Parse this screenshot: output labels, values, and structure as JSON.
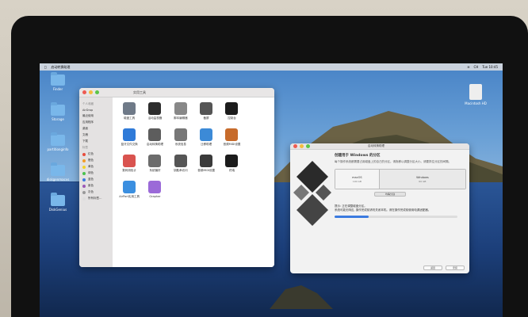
{
  "menubar": {
    "app": "启动转换助理",
    "right": [
      "CH",
      "Tue 10:45"
    ]
  },
  "desktop_icons": [
    {
      "label": "Finder"
    },
    {
      "label": "Storage"
    },
    {
      "label": "partitionginfo"
    },
    {
      "label": "diskgenmacvs"
    },
    {
      "label": "DiskGenius"
    }
  ],
  "hd_icon": {
    "label": "Macintosh HD"
  },
  "finder": {
    "title": "实用工具",
    "sidebar": {
      "favorites_header": "个人收藏",
      "favorites": [
        "AirDrop",
        "最近使用",
        "应用程序",
        "桌面",
        "文稿",
        "下载"
      ],
      "tags_header": "标签",
      "tags": [
        {
          "label": "红色",
          "color": "#e84c3d"
        },
        {
          "label": "橙色",
          "color": "#f29c2b"
        },
        {
          "label": "黄色",
          "color": "#f2d12b"
        },
        {
          "label": "绿色",
          "color": "#49c24d"
        },
        {
          "label": "蓝色",
          "color": "#3b7be0"
        },
        {
          "label": "紫色",
          "color": "#9b59b6"
        },
        {
          "label": "灰色",
          "color": "#999999"
        },
        {
          "label": "所有标签…",
          "color": "#dddddd"
        }
      ]
    },
    "apps": [
      {
        "label": "磁盘工具",
        "color": "#6f7a88"
      },
      {
        "label": "活动监视器",
        "color": "#2d2d2d"
      },
      {
        "label": "脚本编辑器",
        "color": "#888888"
      },
      {
        "label": "截屏",
        "color": "#555555"
      },
      {
        "label": "控制台",
        "color": "#1c1c1c"
      },
      {
        "label": "",
        "color": "#ffffff"
      },
      {
        "label": "蓝牙文件交换",
        "color": "#2f7ad8"
      },
      {
        "label": "启动转换助理",
        "color": "#5d5d5d"
      },
      {
        "label": "系统信息",
        "color": "#777777"
      },
      {
        "label": "迁移助理",
        "color": "#3c8ad7"
      },
      {
        "label": "音频MIDI设置",
        "color": "#c76b2b"
      },
      {
        "label": "",
        "color": "#ffffff"
      },
      {
        "label": "数码测色计",
        "color": "#d9534f"
      },
      {
        "label": "系统偏好",
        "color": "#6c6c6c"
      },
      {
        "label": "钥匙串访问",
        "color": "#555555"
      },
      {
        "label": "音频MIDI设置",
        "color": "#3a3a3a"
      },
      {
        "label": "终端",
        "color": "#1b1b1b"
      },
      {
        "label": "",
        "color": "#ffffff"
      },
      {
        "label": "AirPort实用工具",
        "color": "#3b8fe0"
      },
      {
        "label": "Grapher",
        "color": "#9b6ad8"
      }
    ]
  },
  "bootcamp": {
    "title": "启动转换助理",
    "heading": "创建用于 Windows 的分区",
    "description": "每个操作系统都需要占用磁盘上的自己的分区。请拖移以调整分区大小。请要抓住分区的间隔。",
    "disk_label": "APFS 容器 \"disk1\" 将被分区为:",
    "mac": {
      "title": "macOS",
      "size": "190 GB"
    },
    "win": {
      "title": "Windows",
      "size": "60 GB"
    },
    "split_button": "均等分割",
    "status": "提示: 正在调整磁盘分区。\n系统可能无响应, 操作完成前请勿关闭本机。请在操作完成前使用电源适配器。",
    "progress": 0.28,
    "back_button": "返回",
    "install_button": "安装"
  }
}
